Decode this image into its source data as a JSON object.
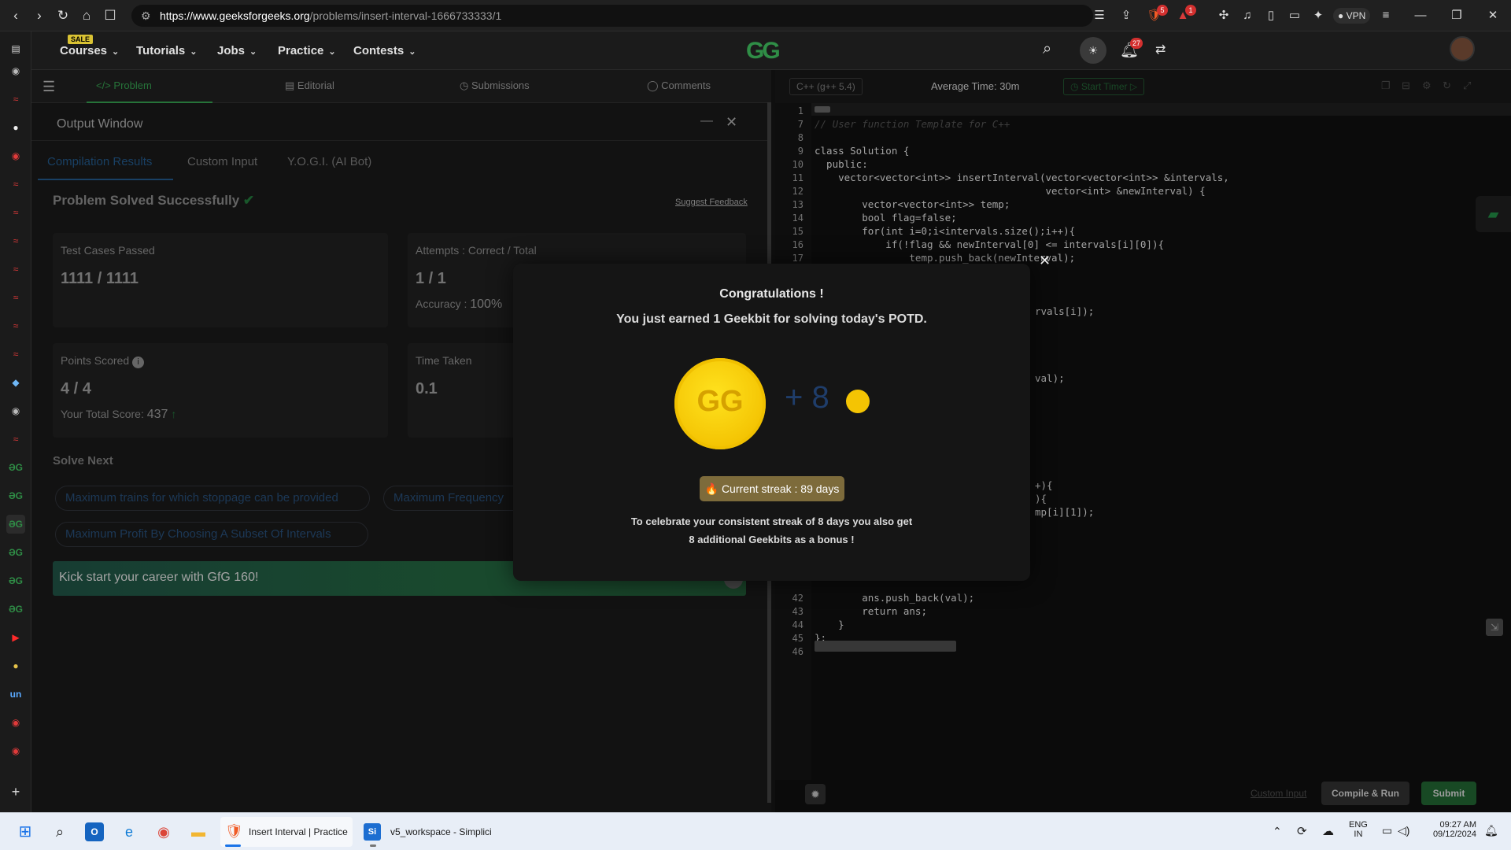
{
  "browser": {
    "url_host": "https://www.geeksforgeeks.org",
    "url_path": "/problems/insert-interval-1666733333/1",
    "brave_badge": "5",
    "alert_badge": "1",
    "vpn_label": "VPN"
  },
  "site": {
    "logo_text": "GG",
    "sale_badge": "SALE",
    "menu": [
      {
        "label": "Courses"
      },
      {
        "label": "Tutorials"
      },
      {
        "label": "Jobs"
      },
      {
        "label": "Practice"
      },
      {
        "label": "Contests"
      }
    ],
    "notification_count": "27"
  },
  "problem_tabs": {
    "problem": "Problem",
    "editorial": "Editorial",
    "submissions": "Submissions",
    "comments": "Comments"
  },
  "output_window": {
    "title": "Output Window",
    "tabs": [
      "Compilation Results",
      "Custom Input",
      "Y.O.G.I. (AI Bot)"
    ],
    "status": "Problem Solved Successfully",
    "suggest_feedback": "Suggest Feedback",
    "test_cases_label": "Test Cases Passed",
    "test_cases_value": "1111 / 1111",
    "attempts_label": "Attempts : Correct / Total",
    "attempts_value": "1 / 1",
    "accuracy_label": "Accuracy :",
    "accuracy_value": "100%",
    "points_label": "Points Scored",
    "points_value": "4 / 4",
    "total_score_label": "Your Total Score:",
    "total_score_value": "437",
    "time_label": "Time Taken",
    "time_value": "0.1",
    "solve_next_label": "Solve Next",
    "solve_next": [
      "Maximum trains for which stoppage can be provided",
      "Maximum Frequency",
      "Maximum Profit By Choosing A Subset Of Intervals"
    ],
    "banner": "Kick start your career with GfG 160!"
  },
  "editor": {
    "language": "C++ (g++ 5.4)",
    "average_time": "Average Time: 30m",
    "start_timer": "Start Timer",
    "lines": [
      {
        "n": "1",
        "code": ""
      },
      {
        "n": "7",
        "code": "// User function Template for C++"
      },
      {
        "n": "8",
        "code": ""
      },
      {
        "n": "9",
        "code": "class Solution {"
      },
      {
        "n": "10",
        "code": "  public:"
      },
      {
        "n": "11",
        "code": "    vector<vector<int>> insertInterval(vector<vector<int>> &intervals,"
      },
      {
        "n": "12",
        "code": "                                       vector<int> &newInterval) {"
      },
      {
        "n": "13",
        "code": "        vector<vector<int>> temp;"
      },
      {
        "n": "14",
        "code": "        bool flag=false;"
      },
      {
        "n": "15",
        "code": "        for(int i=0;i<intervals.size();i++){"
      },
      {
        "n": "16",
        "code": "            if(!flag && newInterval[0] <= intervals[i][0]){"
      },
      {
        "n": "17",
        "code": "                temp.push_back(newInterval);"
      }
    ],
    "partial_lines": [
      {
        "code": "rvals[i]);"
      },
      {
        "code": "val);"
      },
      {
        "code": "+){"
      },
      {
        "code": "){"
      },
      {
        "code": "mp[i][1]);"
      }
    ],
    "tail_lines": [
      {
        "n": "42",
        "code": "        ans.push_back(val);"
      },
      {
        "n": "43",
        "code": "        return ans;"
      },
      {
        "n": "44",
        "code": "    }"
      },
      {
        "n": "45",
        "code": "};"
      },
      {
        "n": "46",
        "code": ""
      }
    ],
    "custom_input": "Custom Input",
    "compile_run": "Compile & Run",
    "submit": "Submit"
  },
  "modal": {
    "title": "Congratulations !",
    "subtitle": "You just earned 1 Geekbit for solving today's POTD.",
    "bonus_plus": "+ 8",
    "streak": "🔥 Current streak : 89 days",
    "celebrate_line1": "To celebrate your consistent streak of 8 days you also get",
    "celebrate_line2": "8 additional Geekbits as a bonus !",
    "close": "✕"
  },
  "taskbar": {
    "app1": "Insert Interval | Practice",
    "app2": "v5_workspace - Simplici",
    "lang": "ENG",
    "region": "IN",
    "time": "09:27 AM",
    "date": "09/12/2024"
  },
  "colors": {
    "gfg_green": "#2f8d46",
    "accent_blue": "#3f86d0",
    "coin_gold": "#f4c403",
    "submit_green": "#1e5a2c"
  }
}
